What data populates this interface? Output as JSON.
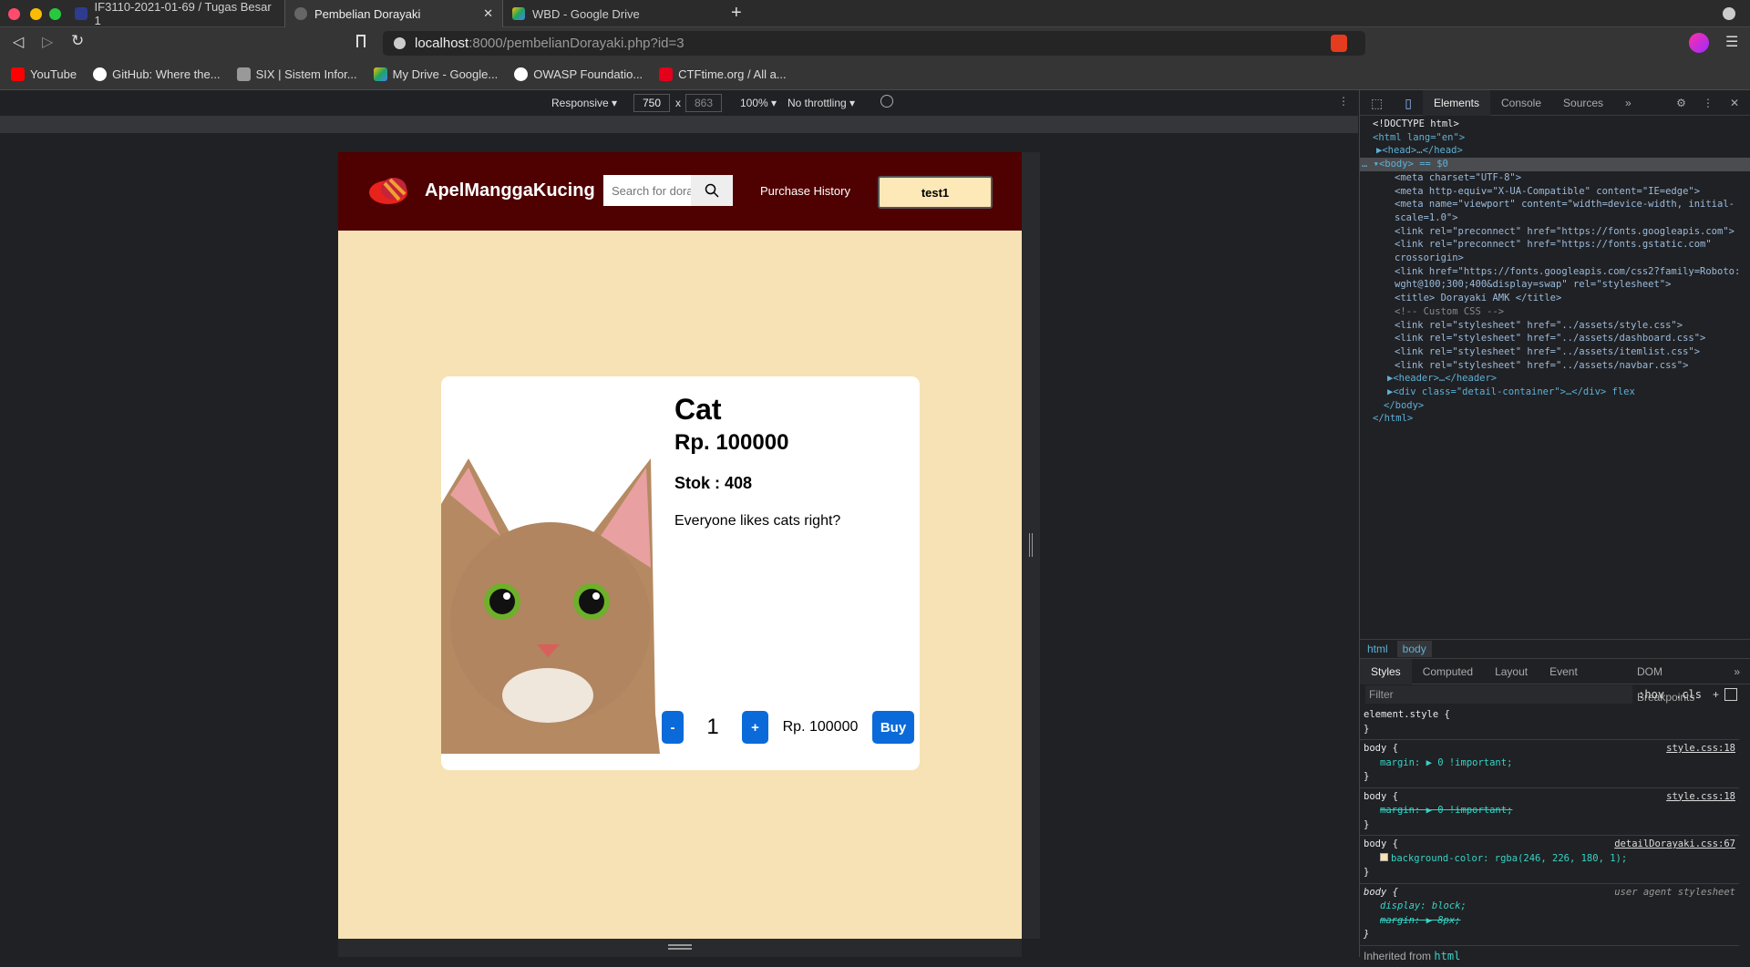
{
  "browser": {
    "tabs": [
      {
        "label": "IF3110-2021-01-69 / Tugas Besar 1",
        "icon": "gitlab-icon",
        "active": false
      },
      {
        "label": "Pembelian Dorayaki",
        "icon": "globe-icon",
        "active": true
      },
      {
        "label": "WBD - Google Drive",
        "icon": "google-drive-icon",
        "active": false
      }
    ],
    "new_tab": "+",
    "url_host": "localhost",
    "url_path": ":8000/pembelianDorayaki.php?id=3",
    "bookmarks": [
      {
        "label": "YouTube",
        "icon": "youtube-icon",
        "color": "#ff0000"
      },
      {
        "label": "GitHub: Where the...",
        "icon": "github-icon",
        "color": "#ffffff"
      },
      {
        "label": "SIX | Sistem Infor...",
        "icon": "six-icon",
        "color": "#bbbbbb"
      },
      {
        "label": "My Drive - Google...",
        "icon": "google-drive-icon",
        "color": "#1fa463"
      },
      {
        "label": "OWASP Foundatio...",
        "icon": "owasp-icon",
        "color": "#ffffff"
      },
      {
        "label": "CTFtime.org / All a...",
        "icon": "ctftime-icon",
        "color": "#e3001b"
      }
    ]
  },
  "device_toolbar": {
    "mode": "Responsive",
    "width": "750",
    "height": "863",
    "zoom": "100%",
    "throttling": "No throttling"
  },
  "page": {
    "brand": "ApelManggaKucing",
    "search_placeholder": "Search for dorayaki",
    "purchase_history": "Purchase History",
    "user": "test1",
    "colors": {
      "navbar": "#4f0000",
      "background": "#f6e2b4",
      "button": "#0a6ad9"
    },
    "product": {
      "name": "Cat",
      "price": "Rp. 100000",
      "stock": "Stok : 408",
      "description": "Everyone likes cats right?",
      "minus": "-",
      "quantity": "1",
      "plus": "+",
      "total": "Rp. 100000",
      "buy": "Buy"
    }
  },
  "devtools": {
    "tabs": [
      "Elements",
      "Console",
      "Sources",
      "»"
    ],
    "breadcrumbs": [
      "html",
      "body"
    ],
    "style_tabs": [
      "Styles",
      "Computed",
      "Layout",
      "Event Listeners",
      "DOM Breakpoints",
      "»"
    ],
    "filter_placeholder": "Filter",
    "filter_tools": [
      ":hov",
      ".cls",
      "+"
    ],
    "dom_lines": [
      "<!DOCTYPE html>",
      "<html lang=\"en\">",
      "▶<head>…</head>",
      "<body> == $0",
      "<meta charset=\"UTF-8\">",
      "<meta http-equiv=\"X-UA-Compatible\" content=\"IE=edge\">",
      "<meta name=\"viewport\" content=\"width=device-width, initial-scale=1.0\">",
      "<link rel=\"preconnect\" href=\"https://fonts.googleapis.com\">",
      "<link rel=\"preconnect\" href=\"https://fonts.gstatic.com\" crossorigin>",
      "<link href=\"https://fonts.googleapis.com/css2?family=Roboto:wght@100;300;400&display=swap\" rel=\"stylesheet\">",
      "<title> Dorayaki AMK </title>",
      "<!-- Custom CSS -->",
      "<link rel=\"stylesheet\" href=\"../assets/style.css\">",
      "<link rel=\"stylesheet\" href=\"../assets/dashboard.css\">",
      "<link rel=\"stylesheet\" href=\"../assets/itemlist.css\">",
      "<link rel=\"stylesheet\" href=\"../assets/navbar.css\">",
      "▶<header>…</header>",
      "▶<div class=\"detail-container\">…</div> flex",
      "</body>",
      "</html>"
    ],
    "rules": [
      {
        "selector": "element.style {",
        "source": "",
        "props": []
      },
      {
        "selector": "body {",
        "source": "style.css:18",
        "props": [
          "margin: ▶ 0 !important;"
        ]
      },
      {
        "selector": "body {",
        "source": "style.css:18",
        "props": [
          "margin: ▶ 0 !important;"
        ],
        "struck": true
      },
      {
        "selector": "body {",
        "source": "detailDorayaki.css:67",
        "props": [
          "background-color: rgba(246, 226, 180, 1);"
        ]
      },
      {
        "selector": "body {",
        "source": "user agent stylesheet",
        "props": [
          "display: block;",
          "margin: ▶ 8px;"
        ]
      }
    ],
    "inherited": "Inherited from",
    "inherited_el": "html"
  }
}
